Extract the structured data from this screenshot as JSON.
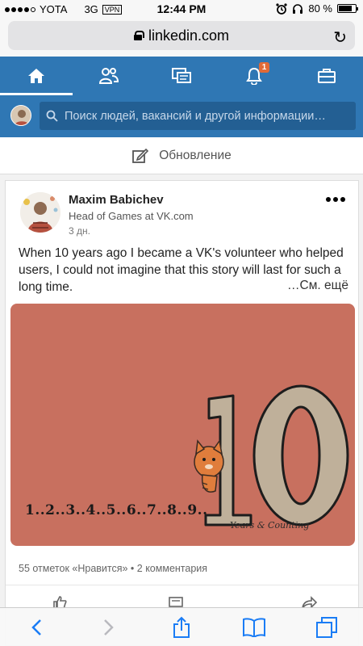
{
  "status_bar": {
    "carrier": "YOTA",
    "network": "3G",
    "vpn": "VPN",
    "time": "12:44 PM",
    "battery_percent": "80 %",
    "battery_level": 0.8
  },
  "browser": {
    "url": "linkedin.com"
  },
  "nav": {
    "items": [
      "home-icon",
      "network-icon",
      "messaging-icon",
      "notifications-icon",
      "jobs-icon"
    ],
    "notification_count": "1",
    "accent": "#2f77b4"
  },
  "search": {
    "placeholder": "Поиск людей, вакансий и другой информации…"
  },
  "update": {
    "label": "Обновление"
  },
  "post": {
    "author": "Maxim Babichev",
    "headline": "Head of Games at VK.com",
    "time": "3 дн.",
    "text": "When 10 years ago I became a VK's volunteer who helped users, I could not imagine that this story will last for such a long time.",
    "see_more": "…См. ещё",
    "image": {
      "counting_text": "1..2..3..4..5..6..7..8..9..",
      "big_number": "10",
      "caption": "Years & Counting",
      "background": "#c8705f"
    },
    "social_counts": "55 отметок «Нравится» • 2 комментария"
  }
}
